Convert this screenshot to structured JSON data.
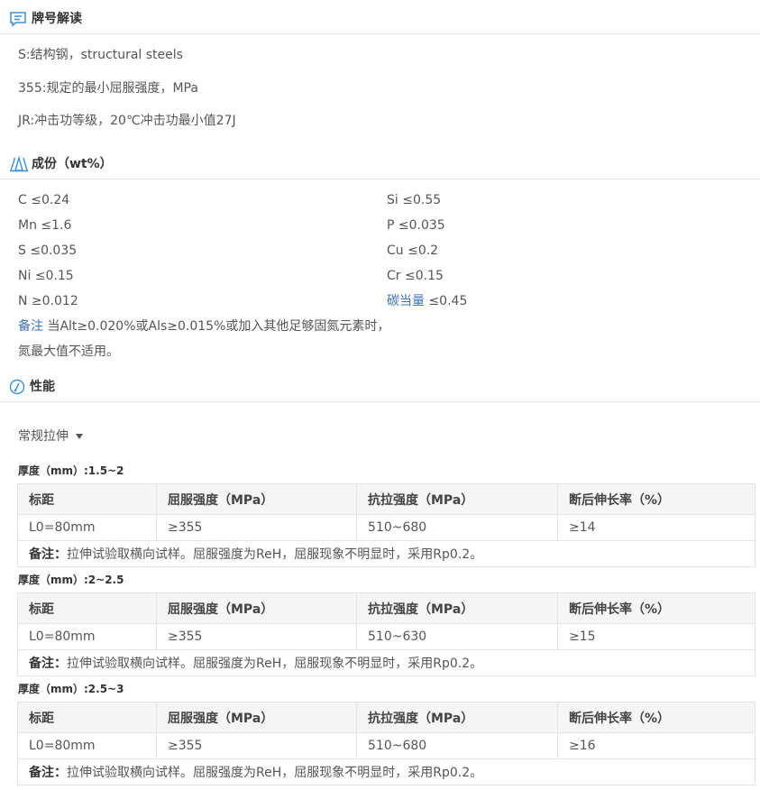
{
  "grade_section": {
    "title": "牌号解读",
    "lines": [
      "S:结构钢，structural steels",
      "355:规定的最小屈服强度，MPa",
      "JR:冲击功等级，20℃冲击功最小值27J"
    ]
  },
  "composition_section": {
    "title": "成份（wt%）",
    "items": [
      {
        "label": "C ≤0.24"
      },
      {
        "label": "Si ≤0.55"
      },
      {
        "label": "Mn ≤1.6"
      },
      {
        "label": "P ≤0.035"
      },
      {
        "label": "S ≤0.035"
      },
      {
        "label": "Cu ≤0.2"
      },
      {
        "label": "Ni ≤0.15"
      },
      {
        "label": "Cr ≤0.15"
      },
      {
        "label": "N ≥0.012"
      }
    ],
    "carbon_equivalent_label": "碳当量",
    "carbon_equivalent_value": " ≤0.45",
    "note_label": "备注",
    "note_line1": " 当Alt≥0.020%或Als≥0.015%或加入其他足够固氮元素时，",
    "note_line2": "氮最大值不适用。"
  },
  "performance_section": {
    "title": "性能",
    "test_type": "常规拉伸",
    "headers": [
      "标距",
      "屈服强度（MPa）",
      "抗拉强度（MPa）",
      "断后伸长率（%）"
    ],
    "remark_label": "备注：",
    "remark_text": "拉伸试验取横向试样。屈服强度为ReH，屈服现象不明显时，采用Rp0.2。",
    "groups": [
      {
        "thickness": "厚度（mm）:1.5~2",
        "row": [
          "L0=80mm",
          "≥355",
          "510~680",
          "≥14"
        ]
      },
      {
        "thickness": "厚度（mm）:2~2.5",
        "row": [
          "L0=80mm",
          "≥355",
          "510~630",
          "≥15"
        ]
      },
      {
        "thickness": "厚度（mm）:2.5~3",
        "row": [
          "L0=80mm",
          "≥355",
          "510~680",
          "≥16"
        ]
      }
    ]
  },
  "colors": {
    "accent": "#3a72b8",
    "border": "#e4e4e4",
    "header_bg": "#f5f5f5"
  }
}
